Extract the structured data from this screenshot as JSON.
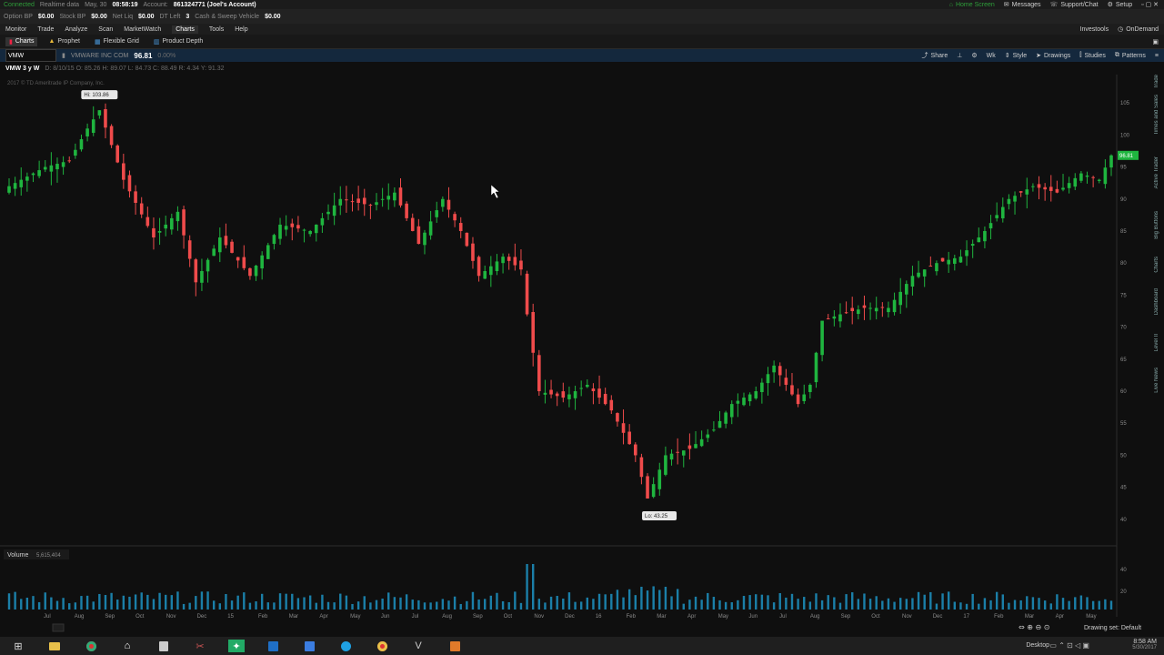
{
  "status": {
    "connection": "Connected",
    "data_feed": "Realtime data",
    "date": "May, 30",
    "time": "08:58:19",
    "account_label": "Account:",
    "account": "861324771 (Joel's Account)",
    "home_screen": "Home Screen",
    "messages": "Messages",
    "support": "Support/Chat",
    "setup": "Setup"
  },
  "account_bar": {
    "option_bp_label": "Option BP",
    "option_bp": "$0.00",
    "stock_bp_label": "Stock BP",
    "stock_bp": "$0.00",
    "net_liq_label": "Net Liq",
    "net_liq": "$0.00",
    "dt_left_label": "DT Left",
    "dt_left": "3",
    "cash_label": "Cash & Sweep Vehicle",
    "cash": "$0.00"
  },
  "menu": {
    "items": [
      "Monitor",
      "Trade",
      "Analyze",
      "Scan",
      "MarketWatch",
      "Charts",
      "Tools",
      "Help"
    ],
    "investools": "Investools",
    "ondemand": "OnDemand"
  },
  "subtabs": [
    "Charts",
    "Prophet",
    "Flexible Grid",
    "Product Depth"
  ],
  "chart_toolbar": {
    "symbol": "VMW",
    "company": "VMWARE INC COM",
    "price": "96.81",
    "change": "0.00%",
    "share": "Share",
    "wk": "Wk",
    "style": "Style",
    "drawings": "Drawings",
    "studies": "Studies",
    "patterns": "Patterns"
  },
  "info_line": {
    "period": "VMW 3 y W",
    "ohlc": "D: 8/10/15   O: 85.26   H: 89.07   L: 84.73   C: 88.49   R: 4.34   Y: 91.32",
    "copyright": "2017 © TD Ameritrade IP Company, Inc."
  },
  "chart_data": {
    "type": "candlestick",
    "symbol": "VMW",
    "period": "3 y W",
    "price_axis": {
      "ticks": [
        105,
        100,
        95,
        90,
        85,
        80,
        75,
        70,
        65,
        60,
        55,
        50,
        45,
        40
      ],
      "range": [
        37,
        108
      ]
    },
    "annotations": {
      "high": "Hi: 103.86",
      "low": "Lo: 43.25",
      "last": "96.81"
    },
    "volume": {
      "label": "Volume",
      "value": "5,615,404",
      "ticks": [
        "40",
        "20"
      ]
    },
    "time_axis_labels": [
      "Jul",
      "Aug",
      "Sep",
      "Oct",
      "Nov",
      "Dec",
      "15",
      "Feb",
      "Mar",
      "Apr",
      "May",
      "Jun",
      "Jul",
      "Aug",
      "Sep",
      "Oct",
      "Nov",
      "Dec",
      "16",
      "Feb",
      "Mar",
      "Apr",
      "May",
      "Jun",
      "Jul",
      "Aug",
      "Sep",
      "Oct",
      "Nov",
      "Dec",
      "17",
      "Feb",
      "Mar",
      "Apr",
      "May"
    ],
    "weekly_close_path": [
      {
        "i": 0,
        "c": 92
      },
      {
        "i": 6,
        "c": 95
      },
      {
        "i": 10,
        "c": 96
      },
      {
        "i": 13,
        "c": 101
      },
      {
        "i": 15,
        "c": 103.86
      },
      {
        "i": 19,
        "c": 93
      },
      {
        "i": 24,
        "c": 84
      },
      {
        "i": 28,
        "c": 88
      },
      {
        "i": 31,
        "c": 77
      },
      {
        "i": 35,
        "c": 84
      },
      {
        "i": 40,
        "c": 78
      },
      {
        "i": 45,
        "c": 86
      },
      {
        "i": 50,
        "c": 85
      },
      {
        "i": 55,
        "c": 90
      },
      {
        "i": 60,
        "c": 89
      },
      {
        "i": 64,
        "c": 91
      },
      {
        "i": 68,
        "c": 83
      },
      {
        "i": 72,
        "c": 90
      },
      {
        "i": 75,
        "c": 85
      },
      {
        "i": 78,
        "c": 78
      },
      {
        "i": 82,
        "c": 81
      },
      {
        "i": 85,
        "c": 79
      },
      {
        "i": 86,
        "c": 72
      },
      {
        "i": 88,
        "c": 60
      },
      {
        "i": 92,
        "c": 59
      },
      {
        "i": 96,
        "c": 61
      },
      {
        "i": 100,
        "c": 57
      },
      {
        "i": 104,
        "c": 50
      },
      {
        "i": 106,
        "c": 43.25
      },
      {
        "i": 109,
        "c": 50
      },
      {
        "i": 113,
        "c": 51
      },
      {
        "i": 117,
        "c": 54
      },
      {
        "i": 120,
        "c": 58
      },
      {
        "i": 124,
        "c": 60
      },
      {
        "i": 127,
        "c": 64
      },
      {
        "i": 131,
        "c": 58
      },
      {
        "i": 133,
        "c": 61
      },
      {
        "i": 135,
        "c": 71
      },
      {
        "i": 138,
        "c": 72
      },
      {
        "i": 142,
        "c": 73
      },
      {
        "i": 146,
        "c": 73
      },
      {
        "i": 150,
        "c": 78
      },
      {
        "i": 154,
        "c": 80
      },
      {
        "i": 158,
        "c": 81
      },
      {
        "i": 162,
        "c": 85
      },
      {
        "i": 166,
        "c": 90
      },
      {
        "i": 170,
        "c": 92
      },
      {
        "i": 174,
        "c": 91
      },
      {
        "i": 178,
        "c": 94
      },
      {
        "i": 181,
        "c": 93
      },
      {
        "i": 183,
        "c": 96.81
      }
    ]
  },
  "footer": {
    "drawing_set": "Drawing set: Default"
  },
  "right_tabs": [
    "Trade",
    "Times and Sales",
    "Active Trader",
    "Big Buttons",
    "Charts",
    "Dashboard",
    "Level II",
    "Live News"
  ],
  "taskbar": {
    "desktop": "Desktop",
    "clock_time": "8:58 AM",
    "clock_date": "5/30/2017",
    "apps": [
      "windows-logo",
      "folder",
      "chrome",
      "home",
      "calculator",
      "snipping",
      "thinkorswim",
      "outlook",
      "snagit",
      "skype",
      "chrome-2",
      "vmware",
      "media-player"
    ]
  },
  "colors": {
    "up": "#1fb53f",
    "down": "#ef4b4b",
    "toolbar": "#14283d",
    "background": "#0f0f0f"
  }
}
